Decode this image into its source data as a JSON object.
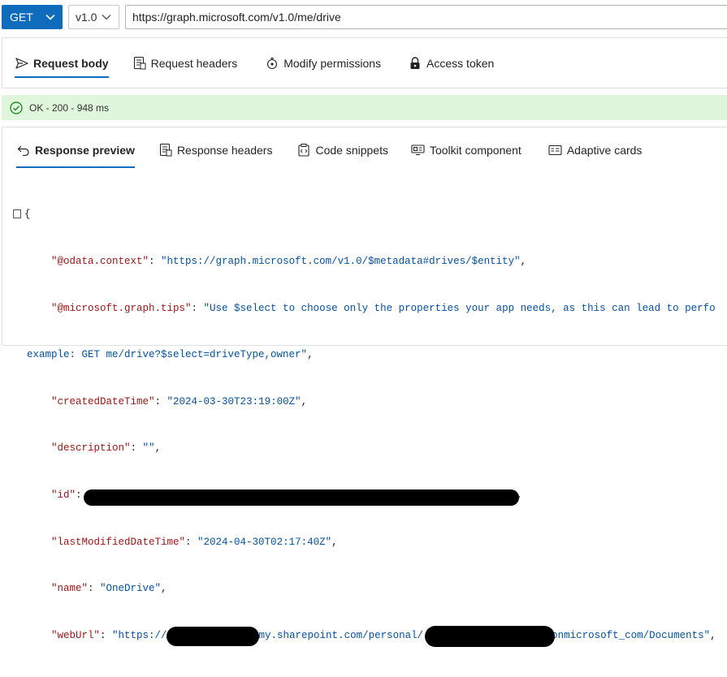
{
  "query": {
    "method": "GET",
    "version": "v1.0",
    "url": "https://graph.microsoft.com/v1.0/me/drive"
  },
  "request_tabs": [
    {
      "label": "Request body",
      "icon": "send-icon",
      "active": true
    },
    {
      "label": "Request headers",
      "icon": "document-header-icon",
      "active": false
    },
    {
      "label": "Modify permissions",
      "icon": "shield-key-icon",
      "active": false
    },
    {
      "label": "Access token",
      "icon": "lock-icon",
      "active": false
    }
  ],
  "status": {
    "text": "OK - 200 - 948 ms",
    "icon": "check-circle-icon",
    "color": "#dff6dd"
  },
  "response_tabs": [
    {
      "label": "Response preview",
      "icon": "undo-arrow-icon",
      "active": true
    },
    {
      "label": "Response headers",
      "icon": "document-header-icon",
      "active": false
    },
    {
      "label": "Code snippets",
      "icon": "clipboard-code-icon",
      "active": false
    },
    {
      "label": "Toolkit component",
      "icon": "toolkit-icon",
      "active": false
    },
    {
      "label": "Adaptive cards",
      "icon": "card-icon",
      "active": false
    }
  ],
  "response": {
    "open_brace": "{",
    "odata_context_key": "\"@odata.context\"",
    "odata_context_value": "\"https://graph.microsoft.com/v1.0/$metadata#drives/$entity\"",
    "tips_key": "\"@microsoft.graph.tips\"",
    "tips_value_start": "\"Use $select to choose only the properties your app needs, as this can lead to perfo",
    "tips_value_end": "example: GET me/drive?$select=driveType,owner\"",
    "created_key": "\"createdDateTime\"",
    "created_value": "\"2024-03-30T23:19:00Z\"",
    "description_key": "\"description\"",
    "description_value": "\"\"",
    "id_key": "\"id\"",
    "modified_key": "\"lastModifiedDateTime\"",
    "modified_value": "\"2024-04-30T02:17:40Z\"",
    "name_key": "\"name\"",
    "name_value": "\"OneDrive\"",
    "weburl_key": "\"webUrl\"",
    "weburl_part1": "\"https://",
    "weburl_part2": "my.sharepoint.com/personal/",
    "weburl_part3": "onmicrosoft_com/Documents\""
  }
}
